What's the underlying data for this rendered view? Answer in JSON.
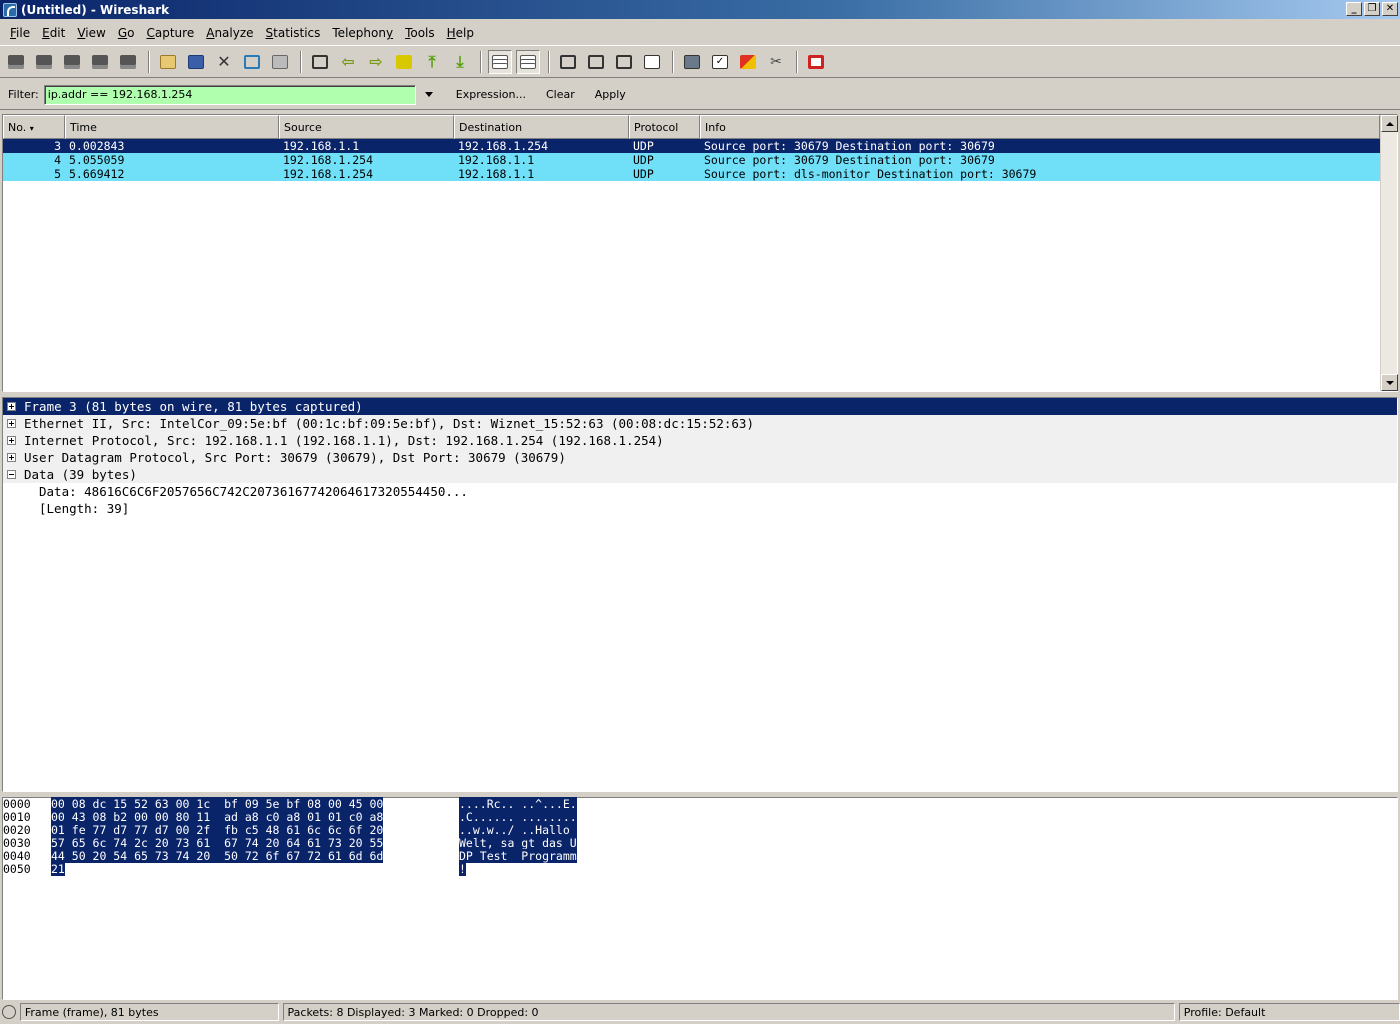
{
  "window": {
    "title": "(Untitled) - Wireshark"
  },
  "menu": [
    {
      "pre": "",
      "u": "F",
      "post": "ile"
    },
    {
      "pre": "",
      "u": "E",
      "post": "dit"
    },
    {
      "pre": "",
      "u": "V",
      "post": "iew"
    },
    {
      "pre": "",
      "u": "G",
      "post": "o"
    },
    {
      "pre": "",
      "u": "C",
      "post": "apture"
    },
    {
      "pre": "",
      "u": "A",
      "post": "nalyze"
    },
    {
      "pre": "",
      "u": "S",
      "post": "tatistics"
    },
    {
      "pre": "Telephon",
      "u": "y",
      "post": ""
    },
    {
      "pre": "",
      "u": "T",
      "post": "ools"
    },
    {
      "pre": "",
      "u": "H",
      "post": "elp"
    }
  ],
  "filter": {
    "label": "Filter:",
    "value": "ip.addr == 192.168.1.254",
    "expression": "Expression...",
    "clear": "Clear",
    "apply": "Apply",
    "valid_color": "#afffaf"
  },
  "packet_list": {
    "columns": [
      "No. ",
      "Time",
      "Source",
      "Destination",
      "Protocol",
      "Info"
    ],
    "rows": [
      {
        "no": "3",
        "time": "0.002843",
        "src": "192.168.1.1",
        "dst": "192.168.1.254",
        "proto": "UDP",
        "info": "Source port: 30679  Destination port: 30679",
        "selected": true
      },
      {
        "no": "4",
        "time": "5.055059",
        "src": "192.168.1.254",
        "dst": "192.168.1.1",
        "proto": "UDP",
        "info": "Source port: 30679  Destination port: 30679",
        "selected": false
      },
      {
        "no": "5",
        "time": "5.669412",
        "src": "192.168.1.254",
        "dst": "192.168.1.1",
        "proto": "UDP",
        "info": "Source port: dls-monitor  Destination port: 30679",
        "selected": false
      }
    ],
    "row_color": "#70e0f8",
    "selected_color": "#0a246a"
  },
  "details": {
    "items": [
      {
        "text": "Frame 3 (81 bytes on wire, 81 bytes captured)",
        "expanded": false,
        "selected": true
      },
      {
        "text": "Ethernet II, Src: IntelCor_09:5e:bf (00:1c:bf:09:5e:bf), Dst: Wiznet_15:52:63 (00:08:dc:15:52:63)",
        "expanded": false,
        "selected": false
      },
      {
        "text": "Internet Protocol, Src: 192.168.1.1 (192.168.1.1), Dst: 192.168.1.254 (192.168.1.254)",
        "expanded": false,
        "selected": false
      },
      {
        "text": "User Datagram Protocol, Src Port: 30679 (30679), Dst Port: 30679 (30679)",
        "expanded": false,
        "selected": false
      },
      {
        "text": "Data (39 bytes)",
        "expanded": true,
        "selected": false
      }
    ],
    "children": [
      "Data: 48616C6C6F2057656C742C20736167742064617320554450...",
      "[Length: 39]"
    ]
  },
  "bytes": [
    {
      "off": "0000",
      "hex": "00 08 dc 15 52 63 00 1c  bf 09 5e bf 08 00 45 00",
      "ascii": "....Rc.. ..^...E."
    },
    {
      "off": "0010",
      "hex": "00 43 08 b2 00 00 80 11  ad a8 c0 a8 01 01 c0 a8",
      "ascii": ".C...... ........"
    },
    {
      "off": "0020",
      "hex": "01 fe 77 d7 77 d7 00 2f  fb c5 48 61 6c 6c 6f 20",
      "ascii": "..w.w../ ..Hallo "
    },
    {
      "off": "0030",
      "hex": "57 65 6c 74 2c 20 73 61  67 74 20 64 61 73 20 55",
      "ascii": "Welt, sa gt das U"
    },
    {
      "off": "0040",
      "hex": "44 50 20 54 65 73 74 20  50 72 6f 67 72 61 6d 6d",
      "ascii": "DP Test  Programm"
    },
    {
      "off": "0050",
      "hex": "21",
      "ascii": "!"
    }
  ],
  "status": {
    "left": "Frame (frame), 81 bytes",
    "middle": "Packets: 8 Displayed: 3 Marked: 0 Dropped: 0",
    "right": "Profile: Default"
  },
  "toolbar_icons": [
    "interface-list-icon",
    "capture-options-icon",
    "capture-start-icon",
    "capture-stop-icon",
    "capture-restart-icon",
    "sep",
    "open-icon",
    "save-icon",
    "close-file-icon",
    "reload-icon",
    "print-icon",
    "sep",
    "find-packet-icon",
    "go-back-icon",
    "go-forward-icon",
    "go-to-packet-icon",
    "go-first-icon",
    "go-last-icon",
    "sep",
    "colorize-icon",
    "auto-scroll-icon",
    "sep",
    "zoom-in-icon",
    "zoom-out-icon",
    "zoom-normal-icon",
    "resize-columns-icon",
    "sep",
    "capture-filters-icon",
    "display-filters-icon",
    "coloring-rules-icon",
    "preferences-icon",
    "sep",
    "help-icon"
  ]
}
